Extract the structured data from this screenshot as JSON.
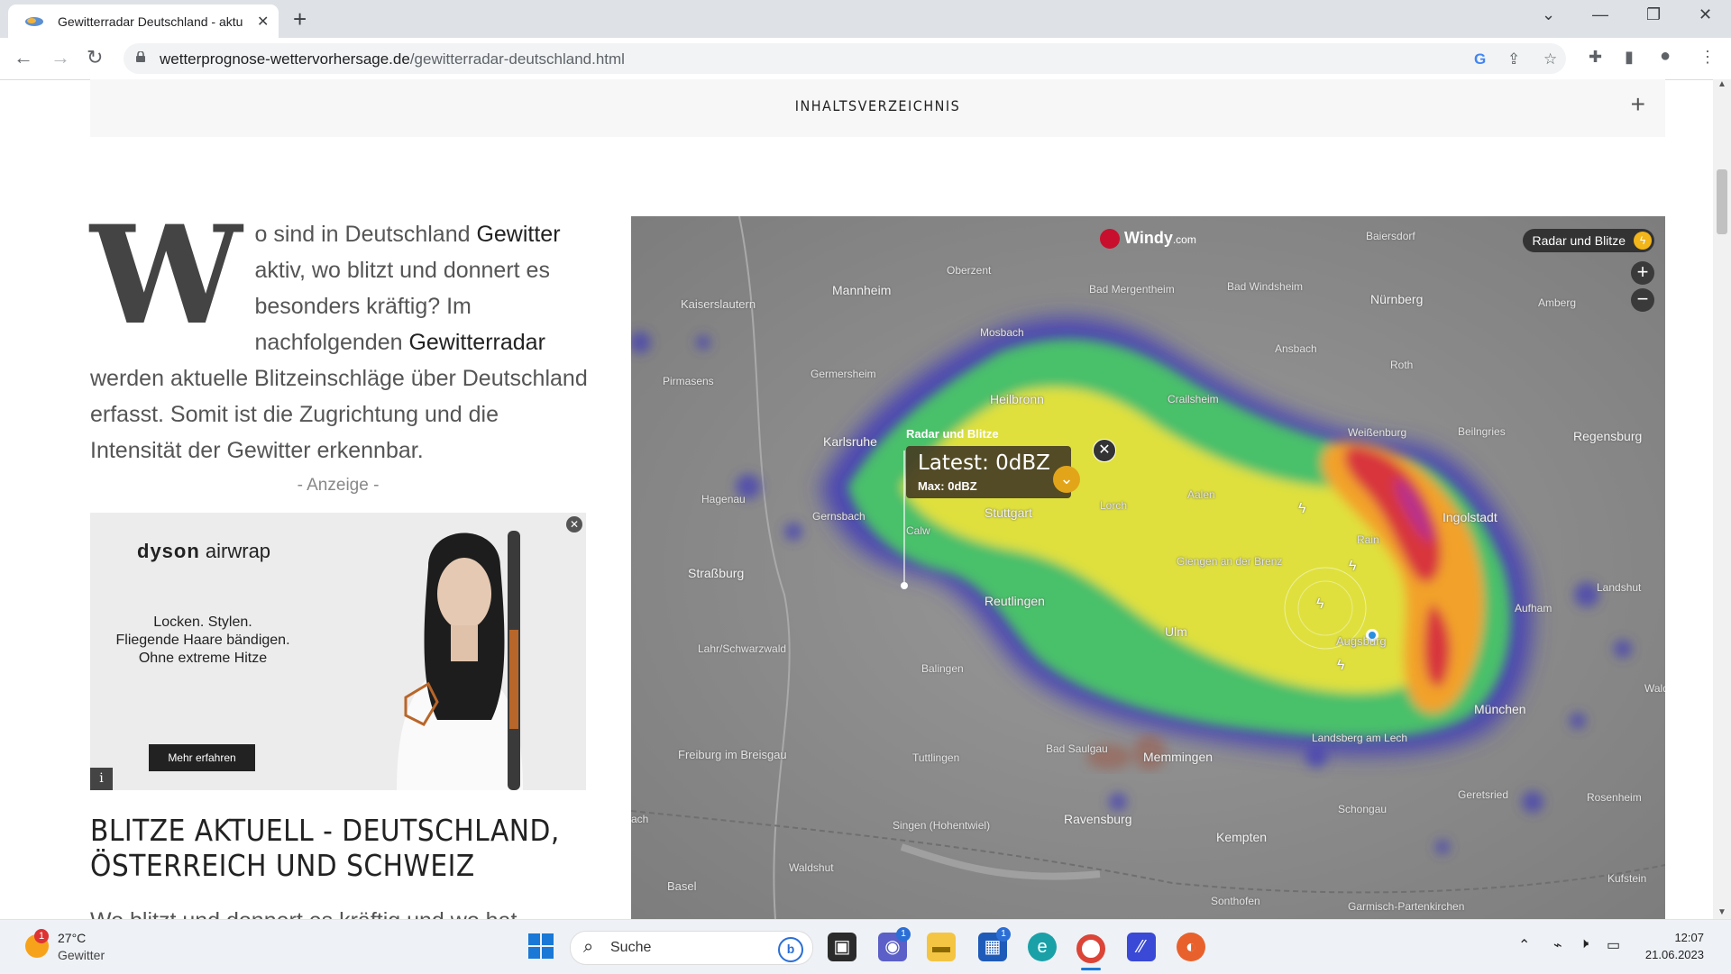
{
  "browser": {
    "tab_title": "Gewitterradar Deutschland - aktu",
    "tab_close": "✕",
    "new_tab": "+",
    "url_domain": "wetterprognose-wettervorhersage.de",
    "url_path": "/gewitterradar-deutschland.html",
    "window_controls": {
      "collapse": "⌄",
      "minimize": "—",
      "restore": "❐",
      "close": "✕"
    }
  },
  "page": {
    "toc_label": "INHALTSVERZEICHNIS",
    "toc_toggle": "+",
    "dropcap": "W",
    "intro_1": "o sind in Deutschland ",
    "intro_bold_1": "Gewitter",
    "intro_2": " aktiv, wo blitzt und donnert es besonders kräftig? Im nachfolgenden ",
    "intro_bold_2": "Gewitterradar",
    "intro_3": " werden aktuelle Blitzeinschläge über Deutschland erfasst. Somit ist die Zugrichtung und die Intensität der Gewitter erkennbar.",
    "ad_label": "- Anzeige -",
    "heading": "BLITZE AKTUELL - DEUTSCHLAND, ÖSTERREICH UND SCHWEIZ",
    "cut_text": "Wo blitzt und donnert es kräftig und wo hat"
  },
  "ad": {
    "brand_bold": "dyson",
    "brand_light": " airwrap",
    "line1": "Locken. Stylen.",
    "line2": "Fliegende Haare bändigen.",
    "line3": "Ohne extreme Hitze",
    "cta": "Mehr erfahren",
    "info": "i",
    "close": "✕"
  },
  "map": {
    "logo": "Windy",
    "logo_suffix": ".com",
    "layer_button": "Radar und Blitze",
    "zoom_in": "+",
    "zoom_out": "−",
    "popup_title": "Radar und Blitze",
    "popup_latest": "Latest: 0dBZ",
    "popup_max": "Max: 0dBZ",
    "popup_close": "✕",
    "cities": [
      {
        "name": "Kaiserslautern"
      },
      {
        "name": "Mannheim"
      },
      {
        "name": "Oberzent"
      },
      {
        "name": "Bad Mergentheim"
      },
      {
        "name": "Bad Windsheim"
      },
      {
        "name": "Nürnberg"
      },
      {
        "name": "Amberg"
      },
      {
        "name": "Baiersdorf"
      },
      {
        "name": "Mosbach"
      },
      {
        "name": "Ansbach"
      },
      {
        "name": "Pirmasens"
      },
      {
        "name": "Germersheim"
      },
      {
        "name": "Heilbronn"
      },
      {
        "name": "Crailsheim"
      },
      {
        "name": "Roth"
      },
      {
        "name": "Karlsruhe"
      },
      {
        "name": "Weißenburg"
      },
      {
        "name": "Beilngries"
      },
      {
        "name": "Regensburg"
      },
      {
        "name": "Hagenau"
      },
      {
        "name": "Gernsbach"
      },
      {
        "name": "Stuttgart"
      },
      {
        "name": "Lorch"
      },
      {
        "name": "Aalen"
      },
      {
        "name": "Ingolstadt"
      },
      {
        "name": "Calw"
      },
      {
        "name": "Straßburg"
      },
      {
        "name": "Giengen an der Brenz"
      },
      {
        "name": "Rain"
      },
      {
        "name": "Landshut"
      },
      {
        "name": "Reutlingen"
      },
      {
        "name": "Aufham"
      },
      {
        "name": "Ulm"
      },
      {
        "name": "Augsburg"
      },
      {
        "name": "Lahr/Schwarzwald"
      },
      {
        "name": "Balingen"
      },
      {
        "name": "München"
      },
      {
        "name": "Wald"
      },
      {
        "name": "Freiburg im Breisgau"
      },
      {
        "name": "Tuttlingen"
      },
      {
        "name": "Bad Saulgau"
      },
      {
        "name": "Memmingen"
      },
      {
        "name": "Landsberg am Lech"
      },
      {
        "name": "Geretsried"
      },
      {
        "name": "Rosenheim"
      },
      {
        "name": "Singen (Hohentwiel)"
      },
      {
        "name": "Ravensburg"
      },
      {
        "name": "Schongau"
      },
      {
        "name": "ach"
      },
      {
        "name": "Kempten"
      },
      {
        "name": "Waldshut"
      },
      {
        "name": "Basel"
      },
      {
        "name": "Sonthofen"
      },
      {
        "name": "Garmisch-Partenkirchen"
      },
      {
        "name": "Kufstein"
      }
    ]
  },
  "taskbar": {
    "weather_badge": "1",
    "temperature": "27°C",
    "condition": "Gewitter",
    "search_placeholder": "Suche",
    "bing": "b",
    "teams_badge": "1",
    "store_badge": "1",
    "time": "12:07",
    "date": "21.06.2023"
  },
  "colors": {
    "radar_blue": "#3f3bb8",
    "radar_green": "#48c06a",
    "radar_yellow": "#e8e23a",
    "radar_orange": "#f2a22a",
    "radar_red": "#d8343c",
    "radar_magenta": "#b8308a",
    "accent_gold": "#e2a51a"
  }
}
